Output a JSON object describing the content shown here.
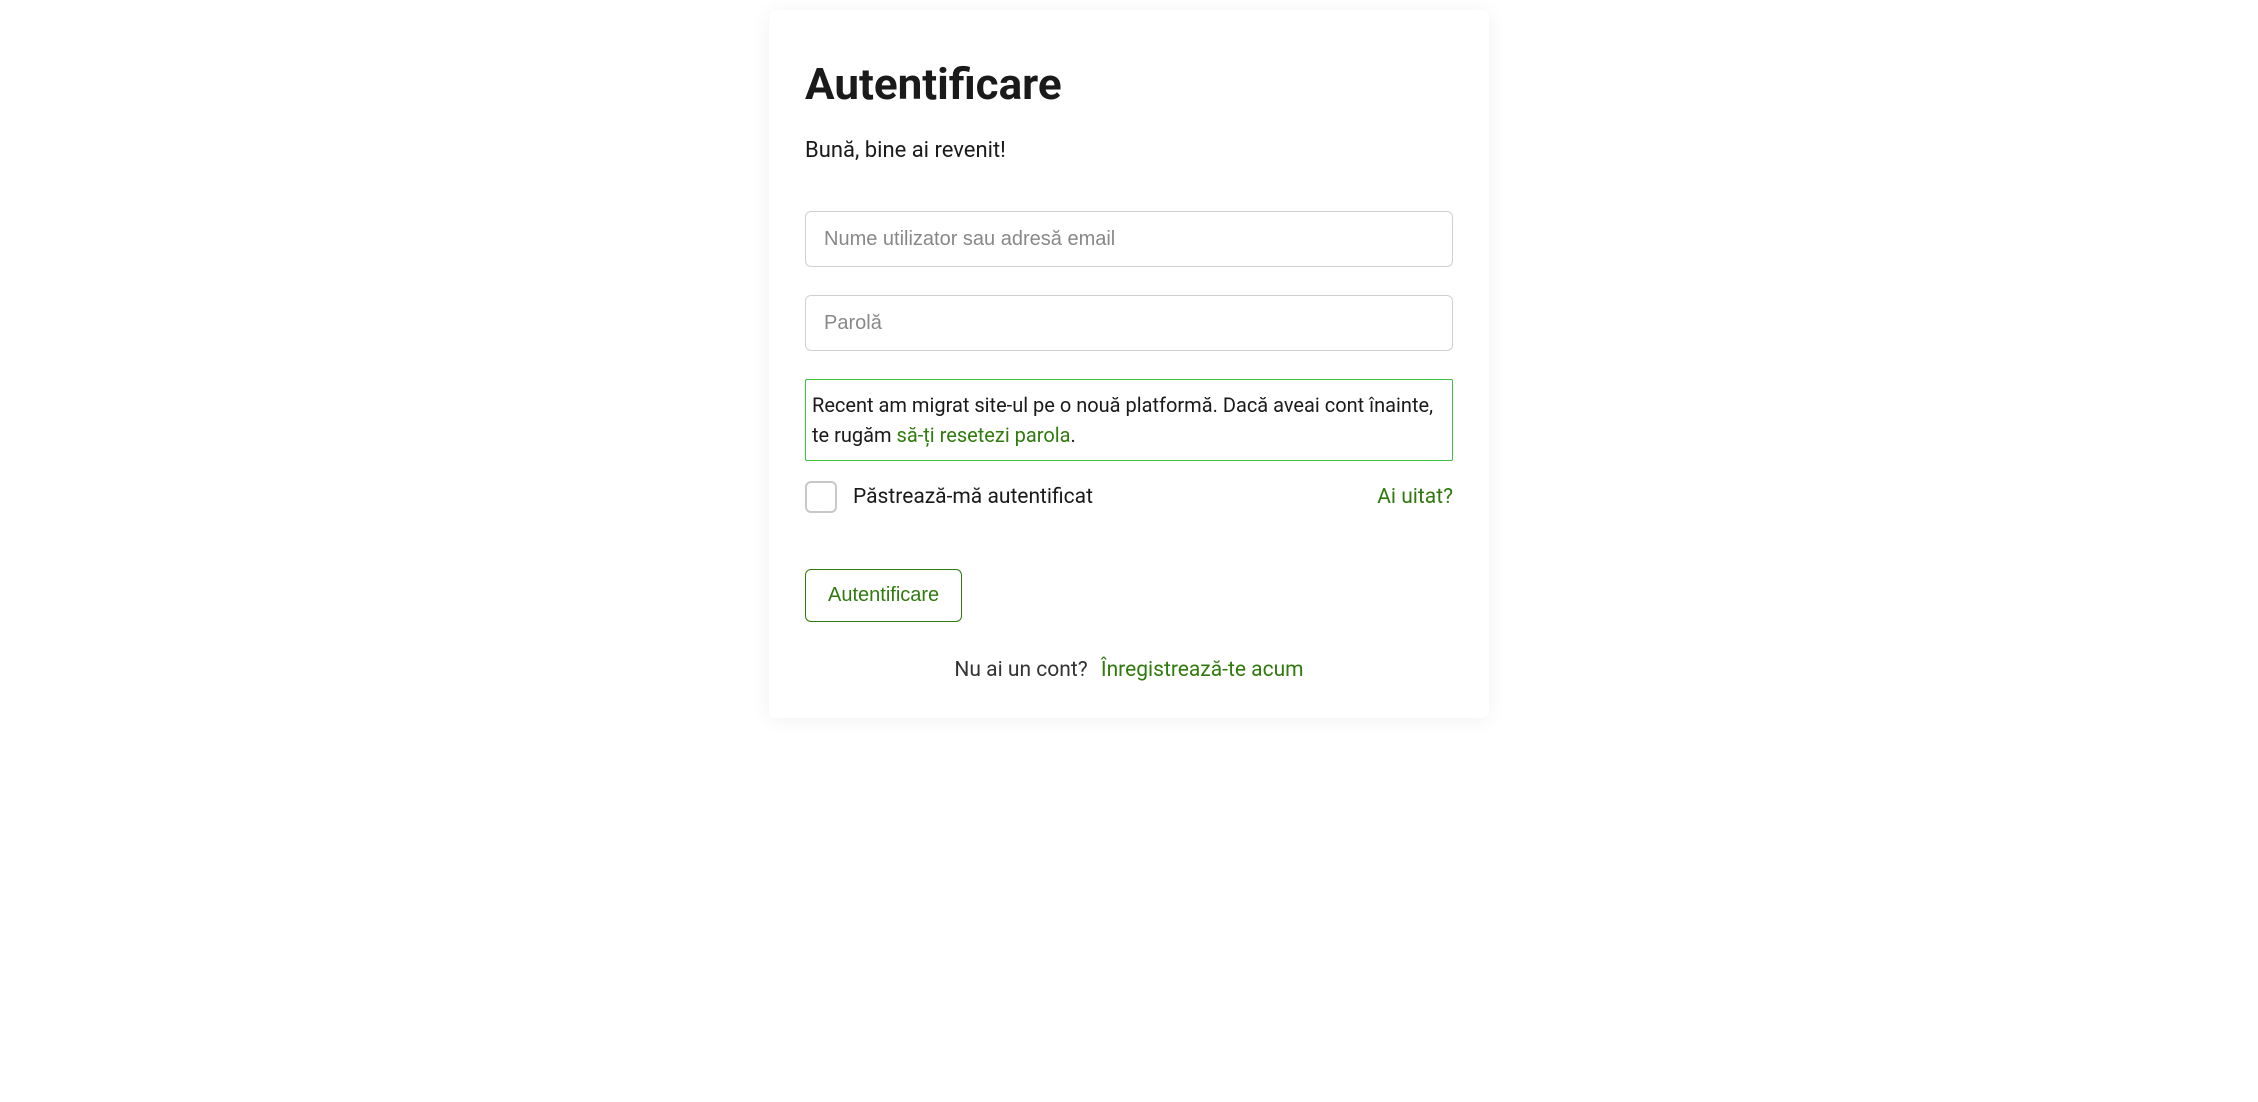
{
  "login": {
    "title": "Autentificare",
    "subtitle": "Bună, bine ai revenit!",
    "username_placeholder": "Nume utilizator sau adresă email",
    "password_placeholder": "Parolă",
    "notice_text": "Recent am migrat site-ul pe o nouă platformă. Dacă aveai cont înainte, te rugăm ",
    "notice_link": "să-ți resetezi parola",
    "notice_suffix": ".",
    "remember_label": "Păstrează-mă autentificat",
    "forgot_label": "Ai uitat?",
    "submit_label": "Autentificare",
    "no_account_text": "Nu ai un cont?",
    "register_label": "Înregistrează-te acum"
  }
}
